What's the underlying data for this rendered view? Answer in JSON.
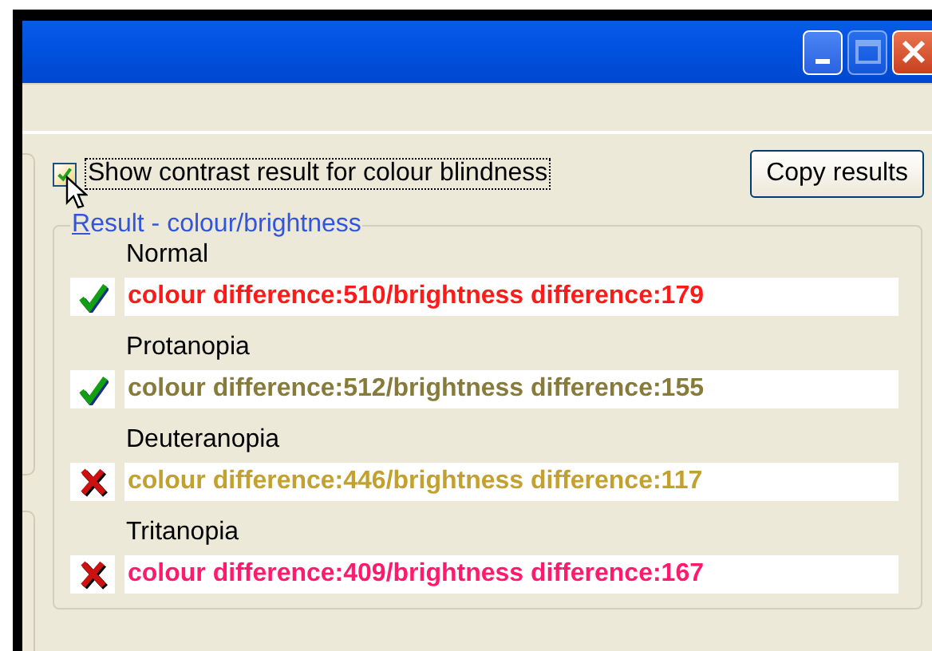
{
  "window": {
    "controls": [
      {
        "kind": "minimize",
        "disabled": false
      },
      {
        "kind": "maximize",
        "disabled": true
      },
      {
        "kind": "close",
        "disabled": false
      }
    ]
  },
  "options": {
    "show_colour_blindness": {
      "label": "Show contrast result for colour blindness",
      "checked": true,
      "focused": true
    },
    "copy_button": "Copy results"
  },
  "result_group": {
    "legend": "Result - colour/brightness",
    "results": [
      {
        "label": "Normal",
        "pass": true,
        "text": "colour difference:510/brightness difference:179",
        "color": "#ff1a1a"
      },
      {
        "label": "Protanopia",
        "pass": true,
        "text": "colour difference:512/brightness difference:155",
        "color": "#877b3c"
      },
      {
        "label": "Deuteranopia",
        "pass": false,
        "text": "colour difference:446/brightness difference:117",
        "color": "#c3a12e"
      },
      {
        "label": "Tritanopia",
        "pass": false,
        "text": "colour difference:409/brightness difference:167",
        "color": "#ff1a6e"
      }
    ]
  }
}
